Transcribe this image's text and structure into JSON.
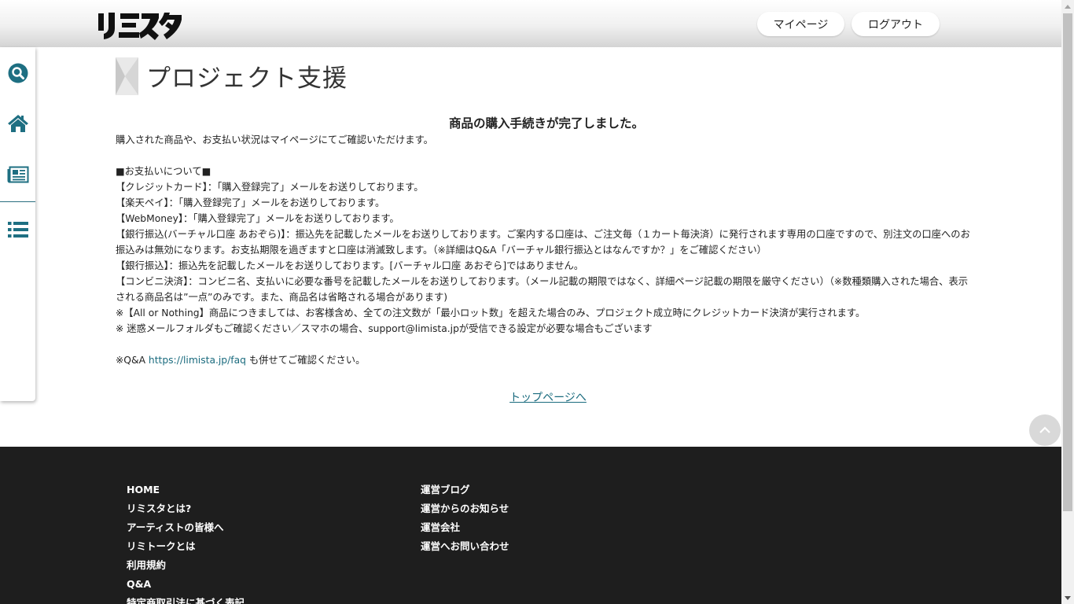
{
  "header": {
    "logo_text": "リミスタ",
    "mypage_label": "マイページ",
    "logout_label": "ログアウト"
  },
  "sidebar": {
    "items": [
      {
        "icon": "search-icon"
      },
      {
        "icon": "home-icon"
      },
      {
        "icon": "news-icon"
      },
      {
        "icon": "list-icon"
      }
    ],
    "accent_color": "#2a6e80"
  },
  "main": {
    "page_title": "プロジェクト支援",
    "done_title": "商品の購入手続きが完了しました。",
    "intro": "購入された商品や、お支払い状況はマイページにてご確認いただけます。",
    "payment_heading": "■お支払いについて■",
    "payment_lines": [
      "【クレジットカード】：「購入登録完了」メールをお送りしております。",
      "【楽天ペイ】：「購入登録完了」メールをお送りしております。",
      "【WebMoney】：「購入登録完了」メールをお送りしております。",
      "【銀行振込(バーチャル口座 あおぞら)】：振込先を記載したメールをお送りしております。ご案内する口座は、ご注文毎（１カート毎決済）に発行されます専用の口座ですので、別注文の口座へのお振込みは無効になります。お支払期限を過ぎますと口座は消滅致します。（※詳細はQ&A「バーチャル銀行振込とはなんですか？」をご確認ください）",
      "【銀行振込】：振込先を記載したメールをお送りしております。[バーチャル口座 あおぞら]ではありません。",
      "【コンビニ決済】：コンビニ名、支払いに必要な番号を記載したメールをお送りしております。（メール記載の期限ではなく、詳細ページ記載の期限を厳守ください）（※数種類購入された場合、表示される商品名は”一点”のみです。また、商品名は省略される場合があります)",
      "※【All or Nothing】商品につきましては、お客様含め、全ての注文数が「最小ロット数」を超えた場合のみ、プロジェクト成立時にクレジットカード決済が実行されます。",
      "※ 迷惑メールフォルダもご確認ください／スマホの場合、support@limista.jpが受信できる設定が必要な場合もございます"
    ],
    "faq_prefix": "※Q&A ",
    "faq_link": "https://limista.jp/faq",
    "faq_suffix": " も併せてご確認ください。",
    "top_link": "トップページへ"
  },
  "footer": {
    "col1": [
      "HOME",
      "リミスタとは?",
      "アーティストの皆様へ",
      "リミトークとは",
      "利用規約",
      "Q&A",
      "特定商取引法に基づく表記"
    ],
    "col2": [
      "運営ブログ",
      "運営からのお知らせ",
      "運営会社",
      "運営へお問い合わせ"
    ]
  }
}
